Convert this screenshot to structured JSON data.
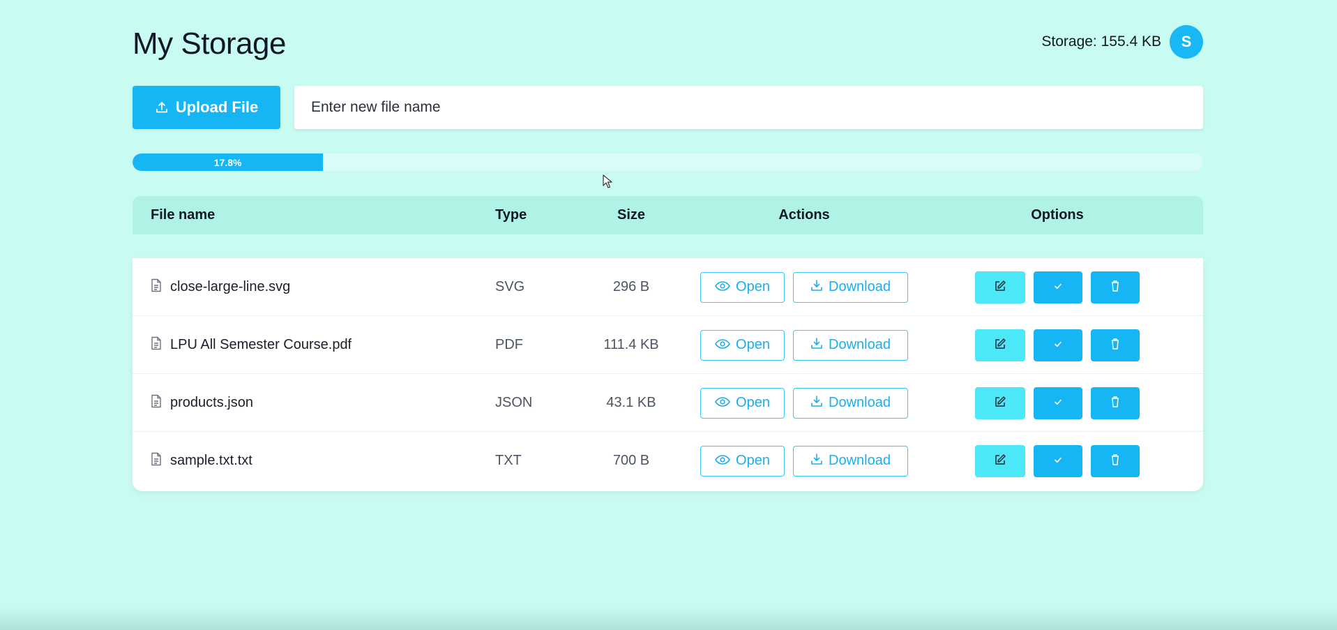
{
  "header": {
    "title": "My Storage",
    "storage_text": "Storage: 155.4 KB",
    "avatar_letter": "S"
  },
  "toolbar": {
    "upload_label": "Upload File",
    "upload_icon": "upload-icon",
    "filename_placeholder": "Enter new file name",
    "filename_value": ""
  },
  "progress": {
    "label": "17.8%",
    "value": 17.8
  },
  "table": {
    "columns": {
      "name": "File name",
      "type": "Type",
      "size": "Size",
      "actions": "Actions",
      "options": "Options"
    },
    "open_label": "Open",
    "download_label": "Download",
    "rows": [
      {
        "name": "close-large-line.svg",
        "type": "SVG",
        "size": "296 B"
      },
      {
        "name": "LPU All Semester Course.pdf",
        "type": "PDF",
        "size": "111.4 KB"
      },
      {
        "name": "products.json",
        "type": "JSON",
        "size": "43.1 KB"
      },
      {
        "name": "sample.txt.txt",
        "type": "TXT",
        "size": "700 B"
      }
    ]
  },
  "colors": {
    "background": "#c8fbf1",
    "accent": "#16b6f4",
    "edit_button": "#4de8f7",
    "table_header": "#b0f3e6"
  }
}
